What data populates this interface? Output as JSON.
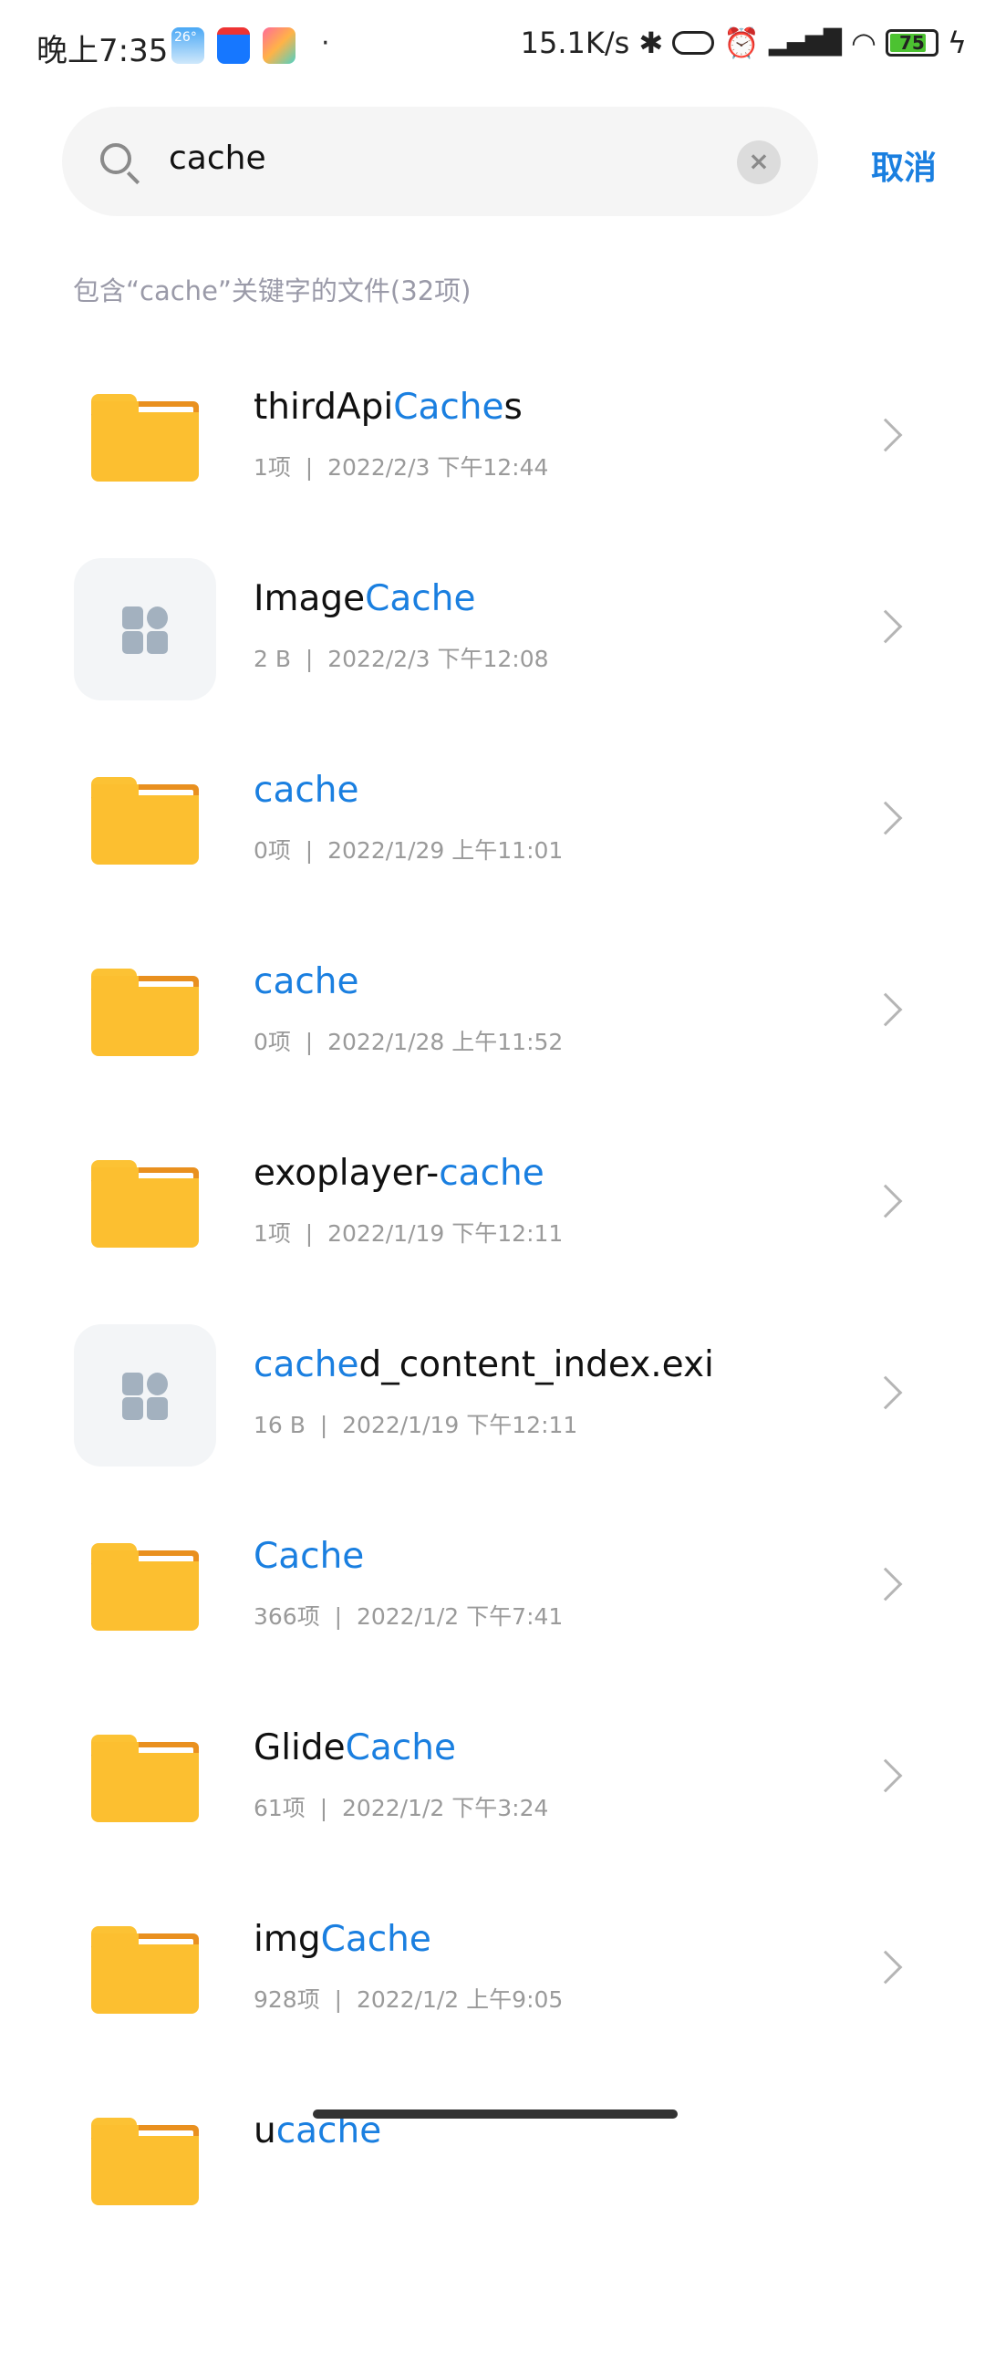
{
  "status_bar": {
    "time": "晚上7:35",
    "net_speed": "15.1K/s",
    "battery": "75",
    "weather_temp": "26°"
  },
  "search": {
    "value": "cache",
    "cancel_label": "取消"
  },
  "result_summary": "包含“cache”关键字的文件(32项)",
  "colors": {
    "accent": "#1a7fe0",
    "folder": "#fcbf30"
  },
  "items": [
    {
      "type": "folder",
      "pre": "thirdApi",
      "match": "Cache",
      "post": "s",
      "size": "1项",
      "date": "2022/2/3 下午12:44"
    },
    {
      "type": "file",
      "pre": "Image",
      "match": "Cache",
      "post": "",
      "size": "2 B",
      "date": "2022/2/3 下午12:08"
    },
    {
      "type": "folder",
      "pre": "",
      "match": "cache",
      "post": "",
      "size": "0项",
      "date": "2022/1/29 上午11:01"
    },
    {
      "type": "folder",
      "pre": "",
      "match": "cache",
      "post": "",
      "size": "0项",
      "date": "2022/1/28 上午11:52"
    },
    {
      "type": "folder",
      "pre": "exoplayer-",
      "match": "cache",
      "post": "",
      "size": "1项",
      "date": "2022/1/19 下午12:11"
    },
    {
      "type": "file",
      "pre": "",
      "match": "cache",
      "post": "d_content_index.exi",
      "size": "16 B",
      "date": "2022/1/19 下午12:11"
    },
    {
      "type": "folder",
      "pre": "",
      "match": "Cache",
      "post": "",
      "size": "366项",
      "date": "2022/1/2 下午7:41"
    },
    {
      "type": "folder",
      "pre": "Glide",
      "match": "Cache",
      "post": "",
      "size": "61项",
      "date": "2022/1/2 下午3:24"
    },
    {
      "type": "folder",
      "pre": "img",
      "match": "Cache",
      "post": "",
      "size": "928项",
      "date": "2022/1/2 上午9:05"
    },
    {
      "type": "folder",
      "pre": "u",
      "match": "cache",
      "post": ""
    }
  ]
}
